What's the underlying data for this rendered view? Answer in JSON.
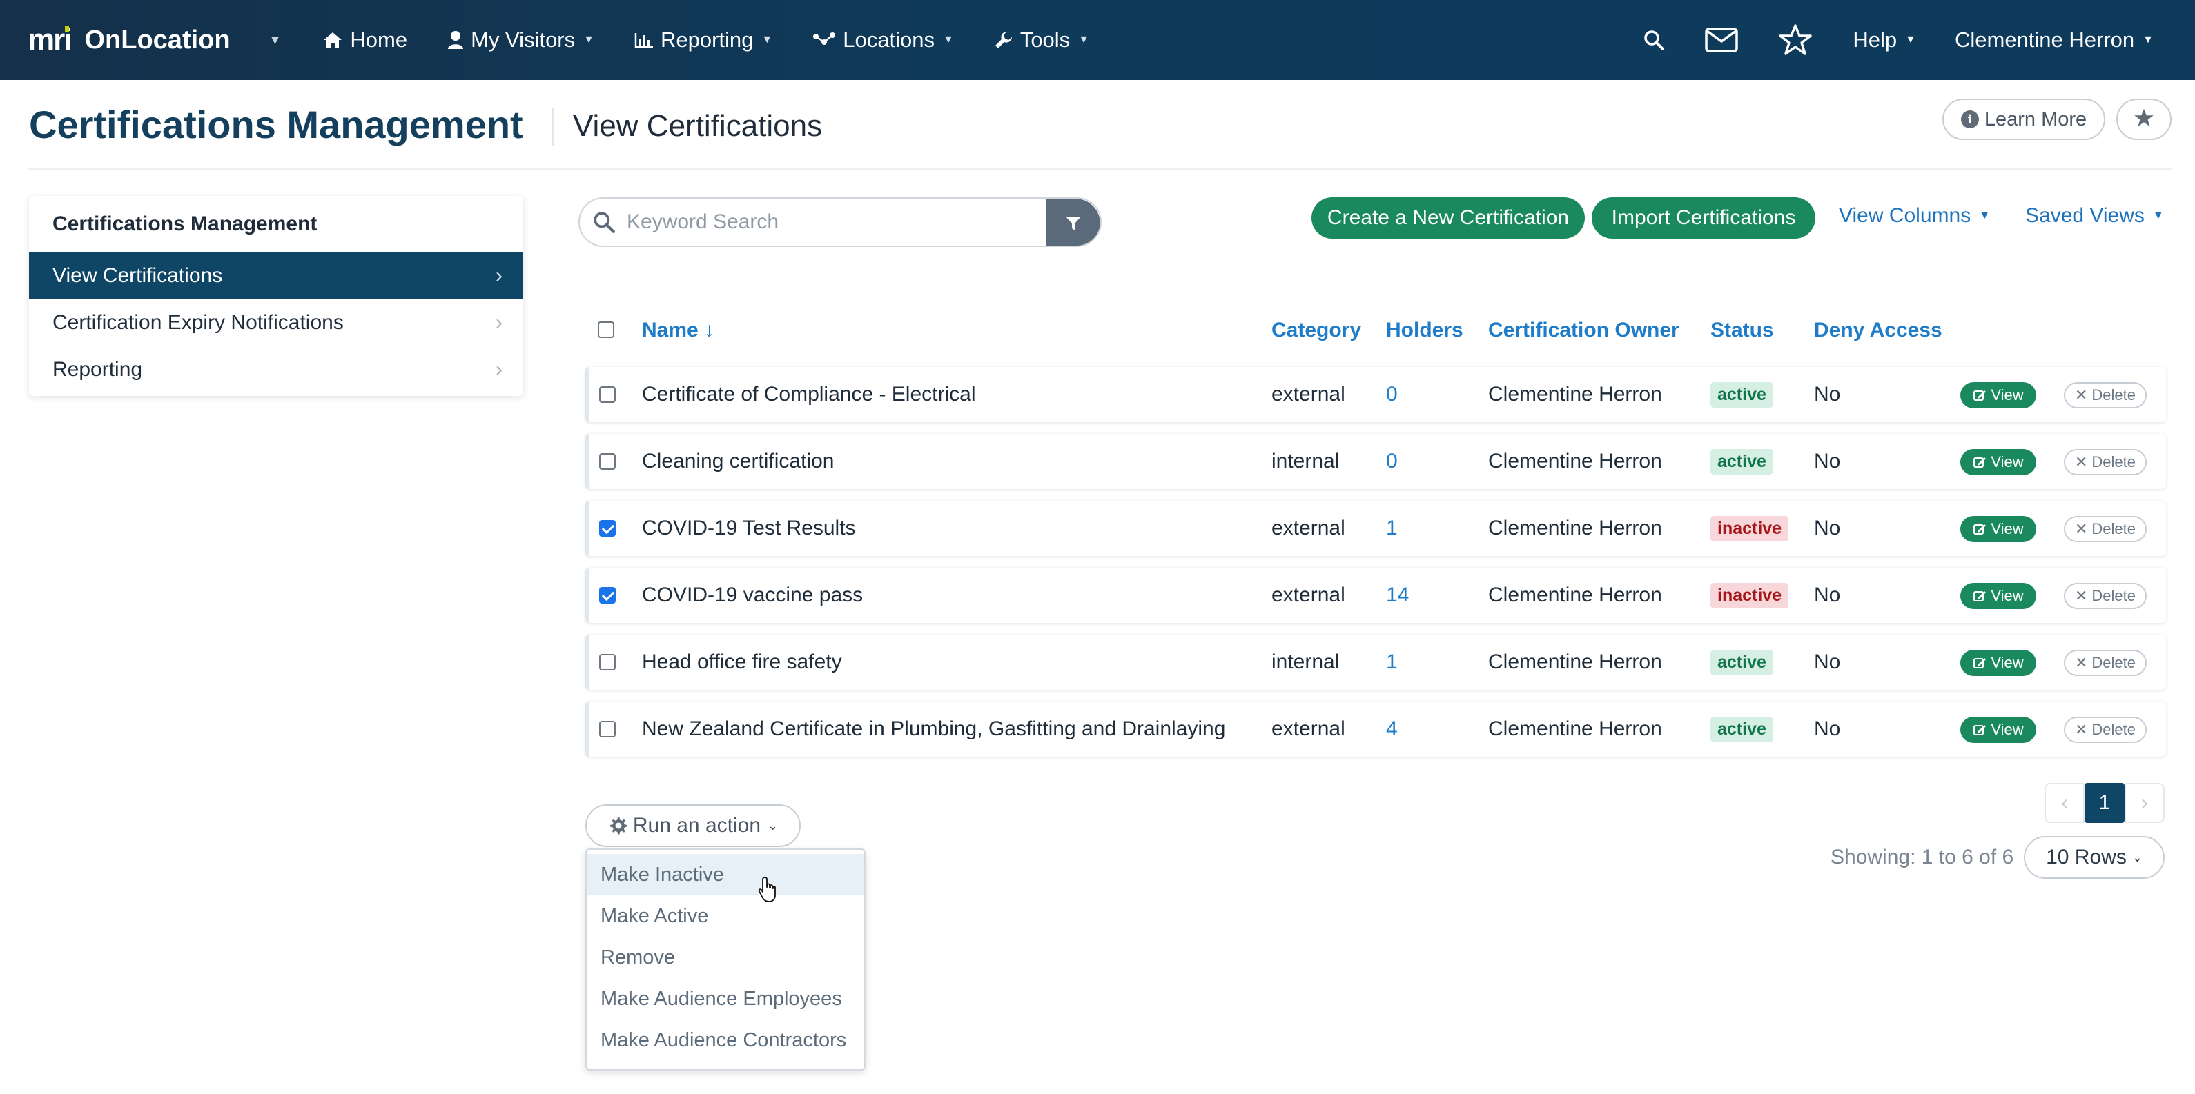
{
  "app": {
    "brand_mark": "mri",
    "name": "OnLocation"
  },
  "nav": {
    "items": [
      {
        "label": "Home",
        "icon": "home-icon"
      },
      {
        "label": "My Visitors",
        "icon": "user-icon"
      },
      {
        "label": "Reporting",
        "icon": "bar-chart-icon"
      },
      {
        "label": "Locations",
        "icon": "network-icon"
      },
      {
        "label": "Tools",
        "icon": "wrench-icon"
      }
    ],
    "help": "Help",
    "user": "Clementine Herron"
  },
  "header": {
    "title": "Certifications Management",
    "subtitle": "View Certifications",
    "learn_more": "Learn More"
  },
  "sidebar": {
    "heading": "Certifications Management",
    "items": [
      {
        "label": "View Certifications",
        "active": true
      },
      {
        "label": "Certification Expiry Notifications",
        "active": false
      },
      {
        "label": "Reporting",
        "active": false
      }
    ]
  },
  "toolbar": {
    "search_placeholder": "Keyword Search",
    "create": "Create a New Certification",
    "import": "Import Certifications",
    "view_columns": "View Columns",
    "saved_views": "Saved Views"
  },
  "table": {
    "columns": [
      "Name ↓",
      "Category",
      "Holders",
      "Certification Owner",
      "Status",
      "Deny Access"
    ],
    "view_label": "View",
    "delete_label": "Delete",
    "rows": [
      {
        "name": "Certificate of Compliance - Electrical",
        "category": "external",
        "holders": "0",
        "owner": "Clementine Herron",
        "status": "active",
        "deny": "No",
        "checked": false
      },
      {
        "name": "Cleaning certification",
        "category": "internal",
        "holders": "0",
        "owner": "Clementine Herron",
        "status": "active",
        "deny": "No",
        "checked": false
      },
      {
        "name": "COVID-19 Test Results",
        "category": "external",
        "holders": "1",
        "owner": "Clementine Herron",
        "status": "inactive",
        "deny": "No",
        "checked": true
      },
      {
        "name": "COVID-19 vaccine pass",
        "category": "external",
        "holders": "14",
        "owner": "Clementine Herron",
        "status": "inactive",
        "deny": "No",
        "checked": true
      },
      {
        "name": "Head office fire safety",
        "category": "internal",
        "holders": "1",
        "owner": "Clementine Herron",
        "status": "active",
        "deny": "No",
        "checked": false
      },
      {
        "name": "New Zealand Certificate in Plumbing, Gasfitting and Drainlaying",
        "category": "external",
        "holders": "4",
        "owner": "Clementine Herron",
        "status": "active",
        "deny": "No",
        "checked": false
      }
    ]
  },
  "actions": {
    "button": "Run an action",
    "menu": [
      "Make Inactive",
      "Make Active",
      "Remove",
      "Make Audience Employees",
      "Make Audience Contractors"
    ],
    "hovered_index": 0
  },
  "pagination": {
    "current_page": "1",
    "showing": "Showing: 1 to 6 of 6",
    "rows": "10 Rows"
  },
  "colors": {
    "nav_bg": "#0f3a5a",
    "primary_green": "#1a8a5e",
    "link_blue": "#1e7cc8",
    "active_sidebar": "#0f4666"
  }
}
